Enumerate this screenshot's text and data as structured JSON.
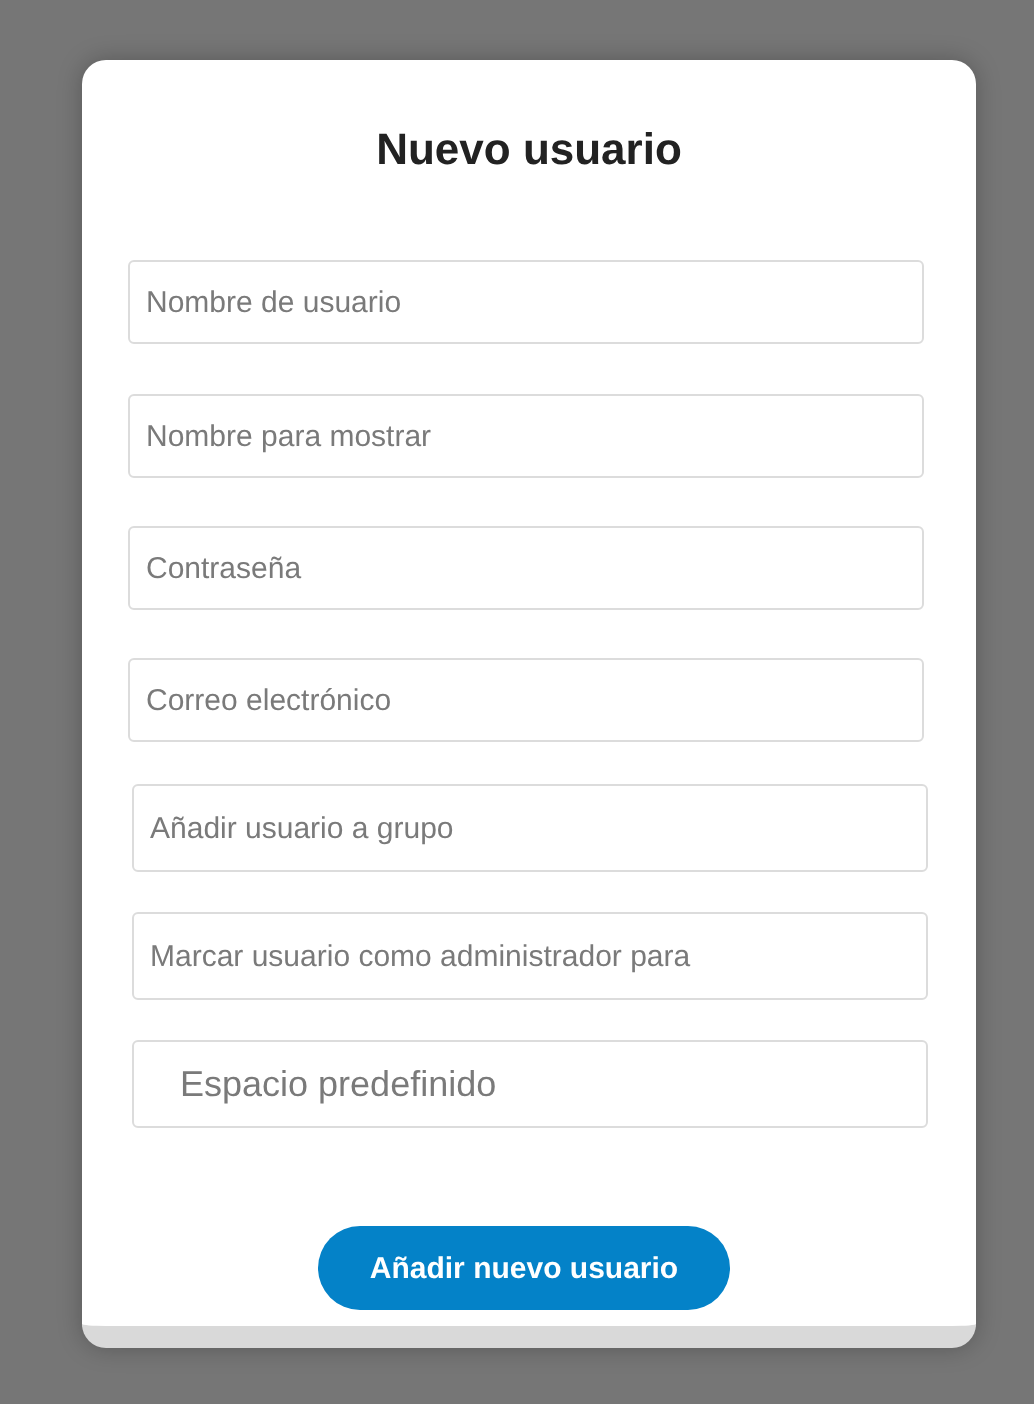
{
  "dialog": {
    "title": "Nuevo usuario",
    "fields": [
      {
        "kind": "text",
        "placeholder": "Nombre de usuario"
      },
      {
        "kind": "text",
        "placeholder": "Nombre para mostrar"
      },
      {
        "kind": "text",
        "placeholder": "Contraseña"
      },
      {
        "kind": "text",
        "placeholder": "Correo electrónico"
      },
      {
        "kind": "picker",
        "placeholder": "Añadir usuario a grupo"
      },
      {
        "kind": "picker",
        "placeholder": "Marcar usuario como administrador para"
      },
      {
        "kind": "large",
        "placeholder": "Espacio predefinido"
      }
    ],
    "submit_button": "Añadir nuevo usuario"
  }
}
